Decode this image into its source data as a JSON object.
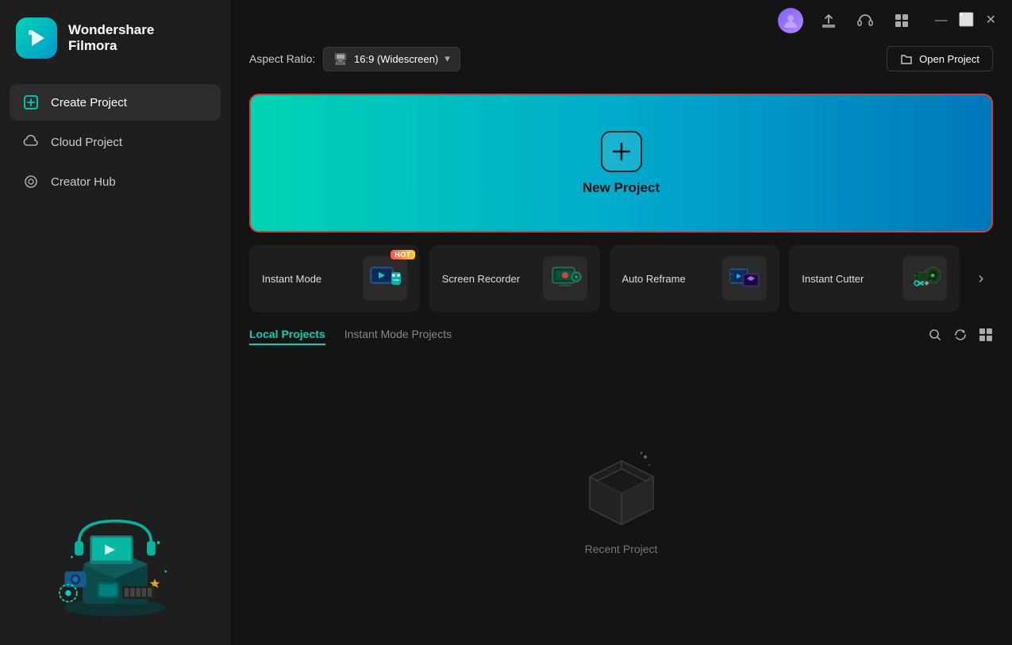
{
  "app": {
    "name": "Wondershare",
    "subtitle": "Filmora",
    "logo_text": "Wondershare\nFilmora"
  },
  "titlebar": {
    "minimize_label": "—",
    "maximize_label": "⬜",
    "close_label": "✕"
  },
  "toolbar": {
    "aspect_ratio_label": "Aspect Ratio:",
    "aspect_ratio_value": "16:9 (Widescreen)",
    "open_project_label": "Open Project"
  },
  "new_project": {
    "label": "New Project"
  },
  "quick_actions": [
    {
      "label": "Instant Mode",
      "hot": true,
      "emoji": "🎬"
    },
    {
      "label": "Screen Recorder",
      "hot": false,
      "emoji": "🖥"
    },
    {
      "label": "Auto Reframe",
      "hot": false,
      "emoji": "🎞"
    },
    {
      "label": "Instant Cutter",
      "hot": false,
      "emoji": "✂"
    }
  ],
  "tabs": [
    {
      "label": "Local Projects",
      "active": true
    },
    {
      "label": "Instant Mode Projects",
      "active": false
    }
  ],
  "empty_state": {
    "label": "Recent Project"
  },
  "sidebar": {
    "items": [
      {
        "label": "Create Project",
        "active": true
      },
      {
        "label": "Cloud Project",
        "active": false
      },
      {
        "label": "Creator Hub",
        "active": false
      }
    ]
  }
}
